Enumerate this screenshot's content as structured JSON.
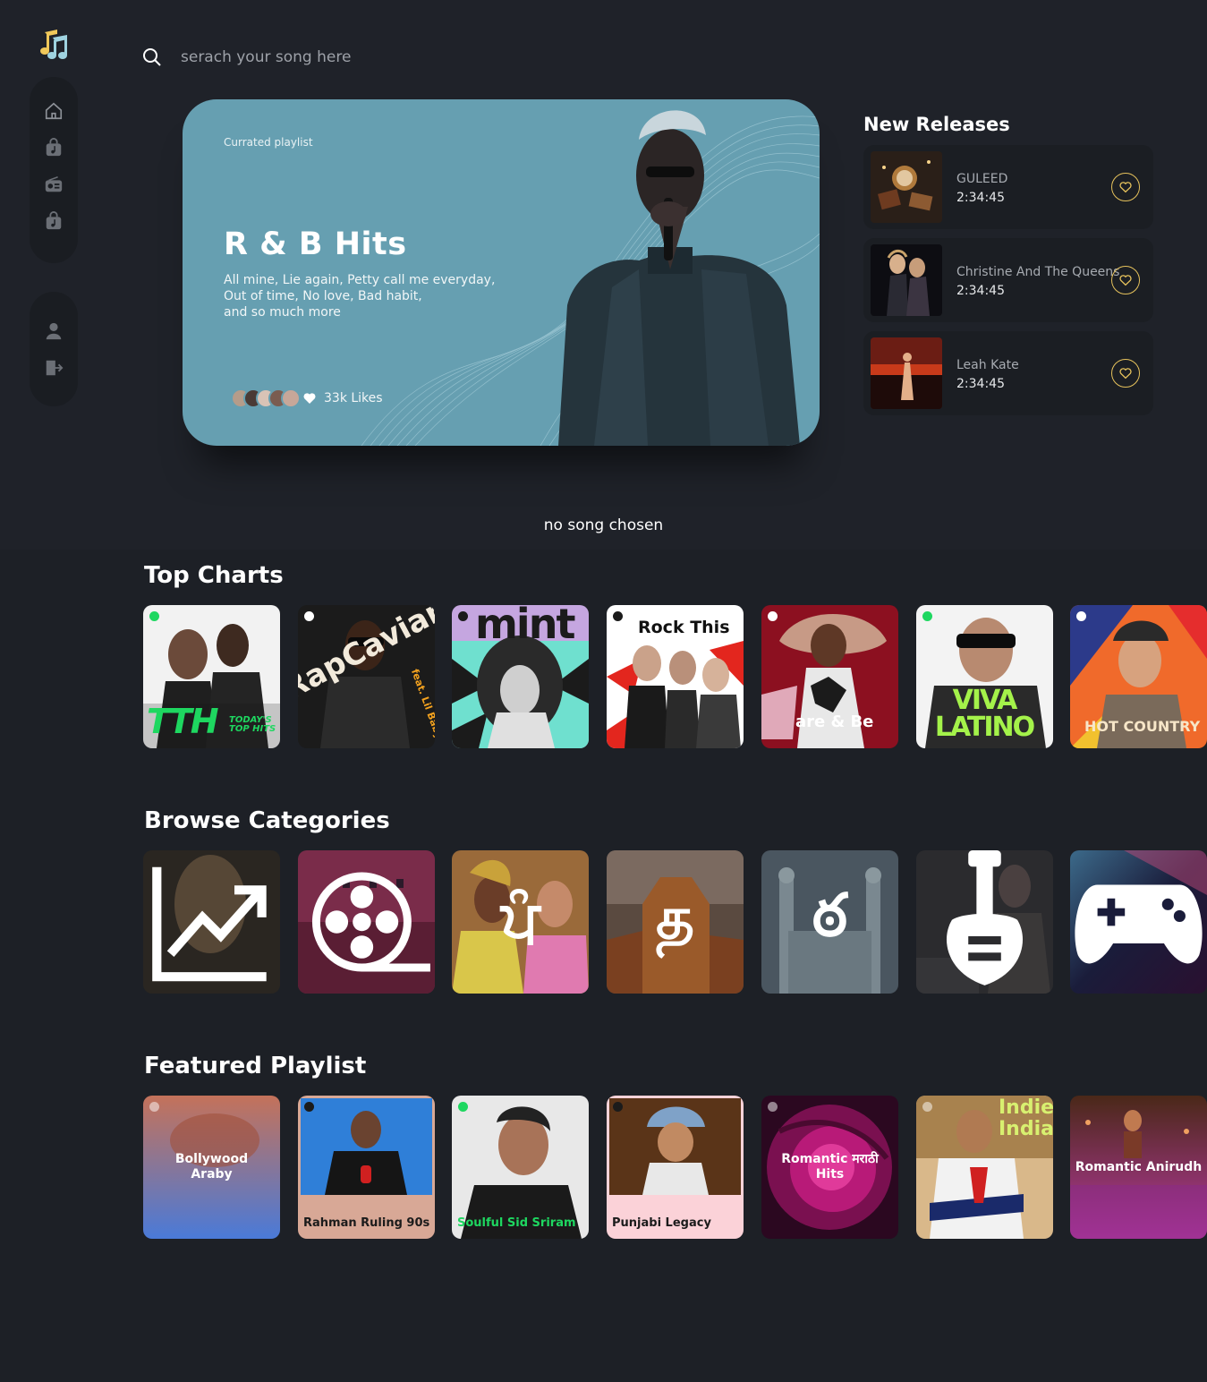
{
  "app": {
    "logo_icon": "music-note-icon",
    "accent": "#e6c25c"
  },
  "sidebar": {
    "main_items": [
      {
        "name": "home",
        "icon": "home-icon"
      },
      {
        "name": "music",
        "icon": "music-bag-icon"
      },
      {
        "name": "radio",
        "icon": "radio-icon"
      },
      {
        "name": "albums",
        "icon": "music-bag-icon"
      }
    ],
    "account_items": [
      {
        "name": "profile",
        "icon": "user-icon"
      },
      {
        "name": "logout",
        "icon": "logout-icon"
      }
    ]
  },
  "search": {
    "placeholder": "serach your song here",
    "value": ""
  },
  "hero": {
    "kicker": "Currated playlist",
    "title": "R & B Hits",
    "description": [
      "All mine, Lie again, Petty call me everyday,",
      "Out of time, No love, Bad habit,",
      "and so much more"
    ],
    "likes": "33k Likes",
    "color": "#669fb1"
  },
  "new_releases": {
    "title": "New Releases",
    "items": [
      {
        "artist": "GULEED",
        "duration": "2:34:45"
      },
      {
        "artist": "Christine And The Queens",
        "duration": "2:34:45"
      },
      {
        "artist": "Leah Kate",
        "duration": "2:34:45"
      }
    ]
  },
  "player": {
    "status": "no song chosen"
  },
  "top_charts": {
    "title": "Top Charts",
    "items": [
      {
        "label": "Today's Top Hits",
        "text": "TTH",
        "sub": "TODAY'S TOP HITS"
      },
      {
        "label": "RapCaviar",
        "text": "RapCaviar",
        "sub": "feat. Lil Baby"
      },
      {
        "label": "mint",
        "text": "mint"
      },
      {
        "label": "Rock This",
        "text": "Rock This"
      },
      {
        "label": "are & Be",
        "text": "are & Be"
      },
      {
        "label": "Viva Latino",
        "text": "VIVA LATINO"
      },
      {
        "label": "Hot Country",
        "text": "HOT COUNTRY"
      }
    ]
  },
  "browse_categories": {
    "title": "Browse Categories",
    "items": [
      {
        "name": "charts",
        "icon": "trending-chart-icon"
      },
      {
        "name": "bollywood",
        "icon": "film-reel-icon"
      },
      {
        "name": "punjabi",
        "glyph": "ਪੰ"
      },
      {
        "name": "tamil",
        "glyph": "த"
      },
      {
        "name": "telugu",
        "glyph": "ఠ"
      },
      {
        "name": "indie",
        "icon": "electric-guitar-icon"
      },
      {
        "name": "gaming",
        "icon": "gamepad-icon"
      }
    ]
  },
  "featured_playlist": {
    "title": "Featured Playlist",
    "items": [
      {
        "label": "Bollywood Araby"
      },
      {
        "label": "Rahman Ruling 90s"
      },
      {
        "label": "Soulful Sid Sriram"
      },
      {
        "label": "Punjabi Legacy"
      },
      {
        "label": "Romantic मराठी Hits"
      },
      {
        "label": "Indie India"
      },
      {
        "label": "Romantic Anirudh"
      }
    ]
  }
}
